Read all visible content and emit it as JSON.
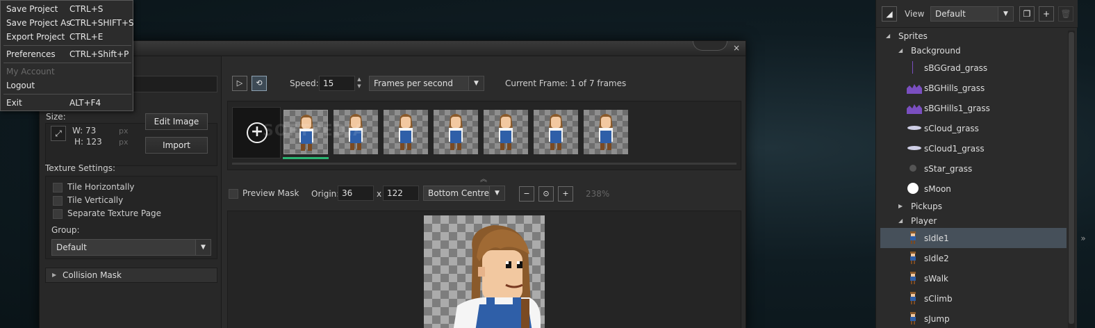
{
  "file_menu": {
    "items": [
      {
        "label": "Save Project",
        "shortcut": "CTRL+S",
        "enabled": true
      },
      {
        "label": "Save Project As",
        "shortcut": "CTRL+SHIFT+S",
        "enabled": true
      },
      {
        "label": "Export Project",
        "shortcut": "CTRL+E",
        "enabled": true
      },
      {
        "label": "Preferences",
        "shortcut": "CTRL+Shift+P",
        "enabled": true
      },
      {
        "label": "My Account",
        "shortcut": "",
        "enabled": false
      },
      {
        "label": "Logout",
        "shortcut": "",
        "enabled": true
      },
      {
        "label": "Exit",
        "shortcut": "ALT+F4",
        "enabled": true
      }
    ]
  },
  "sprite_editor": {
    "close_glyph": "×",
    "size": {
      "label": "Size:",
      "width_label": "W: 73",
      "height_label": "H: 123",
      "unit": "px"
    },
    "buttons": {
      "edit_image": "Edit Image",
      "import": "Import"
    },
    "texture": {
      "label": "Texture Settings:",
      "tile_h": "Tile Horizontally",
      "tile_v": "Tile Vertically",
      "separate": "Separate Texture Page",
      "group_label": "Group:",
      "group_value": "Default"
    },
    "collision_mask": "Collision Mask",
    "playback": {
      "speed_label": "Speed:",
      "speed_value": "15",
      "speed_unit": "Frames per second",
      "current_frame": "Current Frame: 1 of 7 frames"
    },
    "frame_count": 7,
    "watermark": "SOFTPEDIA",
    "preview": {
      "preview_mask": "Preview Mask",
      "origin_label": "Origin:",
      "origin_x": "36",
      "x_sep": "x",
      "origin_y": "122",
      "origin_preset": "Bottom Centre",
      "zoom": "238%"
    }
  },
  "resources": {
    "view_label": "View",
    "view_value": "Default",
    "tree": [
      {
        "label": "Sprites",
        "level": 0,
        "expanded": true
      },
      {
        "label": "Background",
        "level": 1,
        "expanded": true
      },
      {
        "label": "sBGGrad_grass",
        "level": 2,
        "thumb": "line"
      },
      {
        "label": "sBGHills_grass",
        "level": 2,
        "thumb": "hills"
      },
      {
        "label": "sBGHills1_grass",
        "level": 2,
        "thumb": "hills"
      },
      {
        "label": "sCloud_grass",
        "level": 2,
        "thumb": "cloud"
      },
      {
        "label": "sCloud1_grass",
        "level": 2,
        "thumb": "cloud"
      },
      {
        "label": "sStar_grass",
        "level": 2,
        "thumb": "star"
      },
      {
        "label": "sMoon",
        "level": 2,
        "thumb": "moon"
      },
      {
        "label": "Pickups",
        "level": 1,
        "expanded": false
      },
      {
        "label": "Player",
        "level": 1,
        "expanded": true
      },
      {
        "label": "sIdle1",
        "level": 2,
        "thumb": "char",
        "selected": true
      },
      {
        "label": "sIdle2",
        "level": 2,
        "thumb": "char"
      },
      {
        "label": "sWalk",
        "level": 2,
        "thumb": "char"
      },
      {
        "label": "sClimb",
        "level": 2,
        "thumb": "char"
      },
      {
        "label": "sJump",
        "level": 2,
        "thumb": "char"
      }
    ]
  },
  "colors": {
    "accent_green": "#2bb673",
    "selection": "#46505a",
    "hills_purple": "#7a4fc0"
  }
}
